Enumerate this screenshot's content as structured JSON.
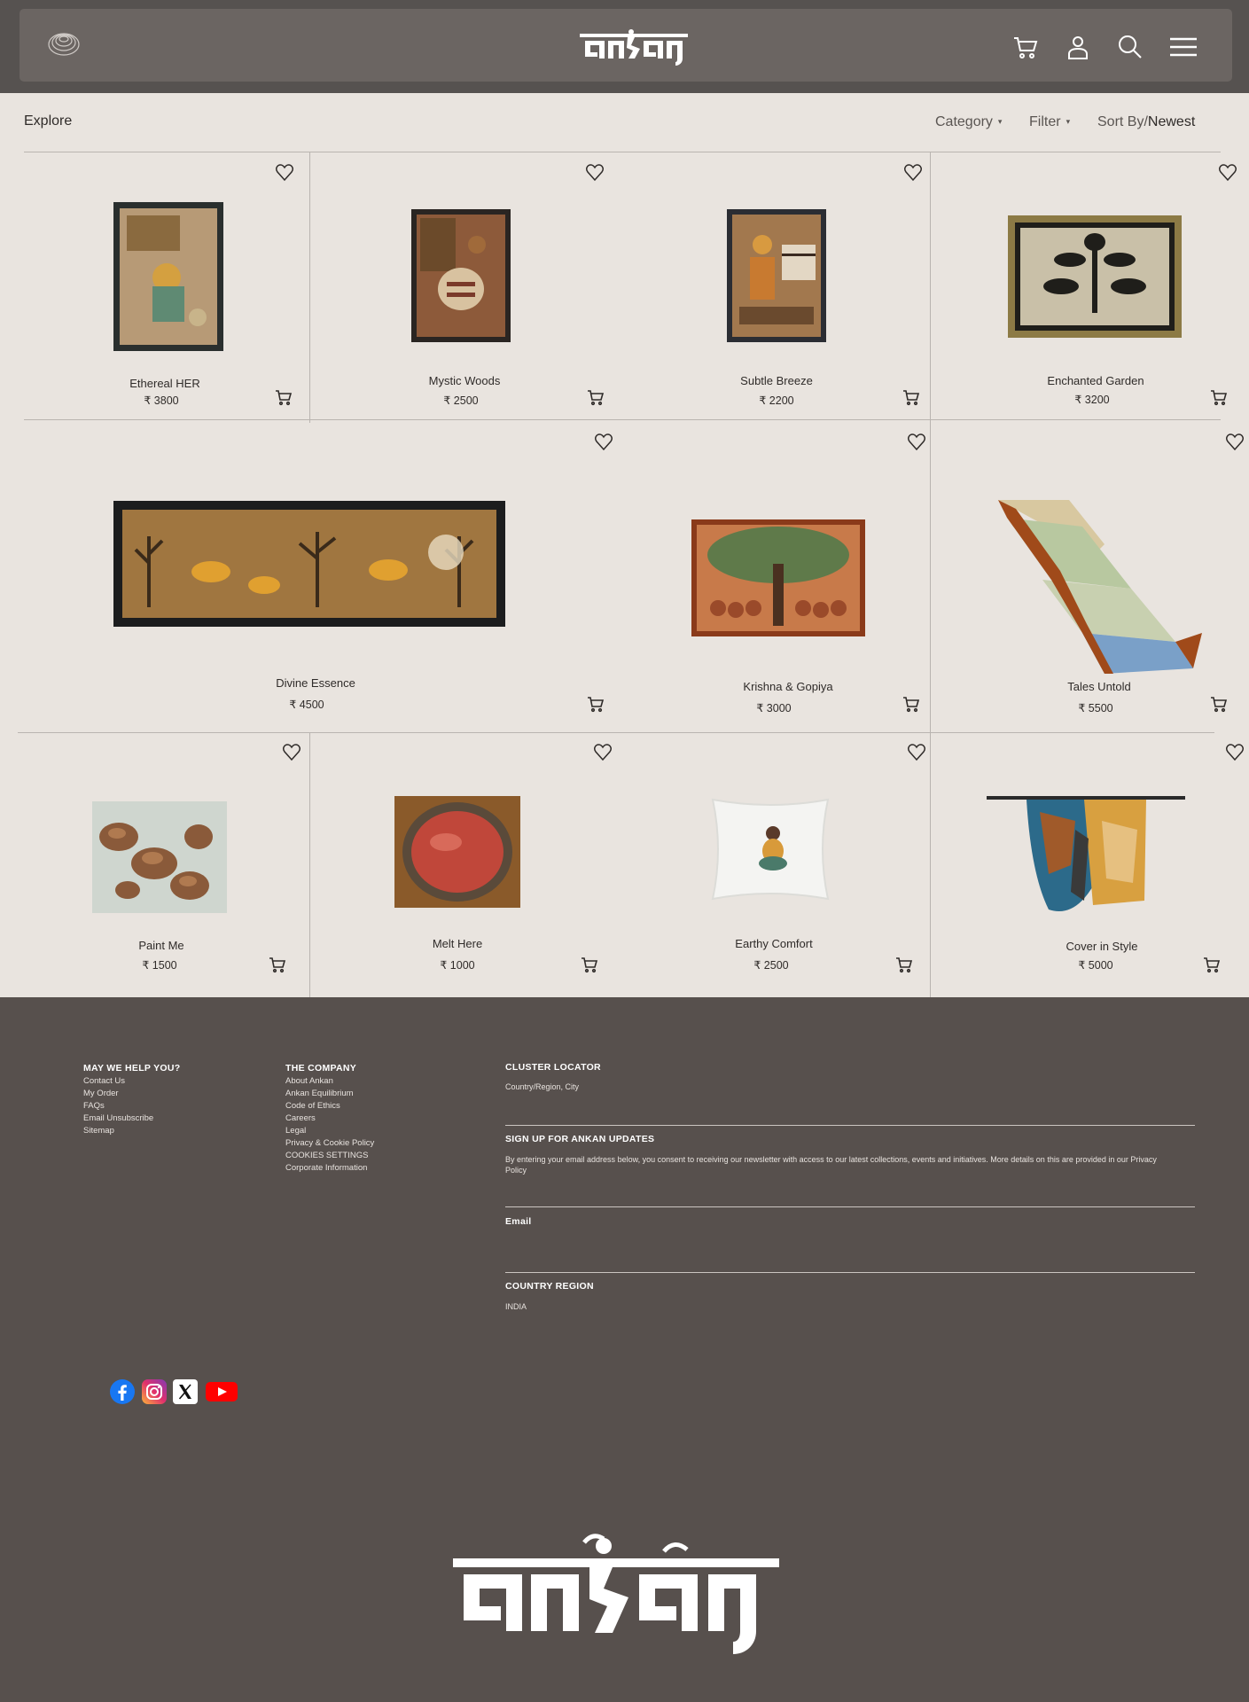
{
  "header": {
    "brand": "ankan",
    "icons": [
      "logo-mark",
      "cart-icon",
      "user-icon",
      "search-icon",
      "menu-icon"
    ]
  },
  "toolbar": {
    "explore_label": "Explore",
    "category_label": "Category",
    "filter_label": "Filter",
    "sort_prefix": "Sort By/",
    "sort_value": "Newest"
  },
  "products": [
    {
      "name": "Ethereal HER",
      "price": "₹ 3800"
    },
    {
      "name": "Mystic Woods",
      "price": "₹ 2500"
    },
    {
      "name": "Subtle Breeze",
      "price": "₹ 2200"
    },
    {
      "name": "Enchanted Garden",
      "price": "₹ 3200"
    },
    {
      "name": "Divine Essence",
      "price": "₹ 4500"
    },
    {
      "name": "Krishna & Gopiya",
      "price": "₹ 3000"
    },
    {
      "name": "Tales Untold",
      "price": "₹ 5500"
    },
    {
      "name": "Paint Me",
      "price": "₹ 1500"
    },
    {
      "name": "Melt Here",
      "price": "₹ 1000"
    },
    {
      "name": "Earthy Comfort",
      "price": "₹ 2500"
    },
    {
      "name": "Cover in Style",
      "price": "₹ 5000"
    }
  ],
  "footer": {
    "help": {
      "title": "MAY WE HELP YOU?",
      "links": [
        "Contact Us",
        "My Order",
        "FAQs",
        "Email Unsubscribe",
        "Sitemap"
      ]
    },
    "company": {
      "title": "THE COMPANY",
      "links": [
        "About Ankan",
        "Ankan Equilibrium",
        "Code of Ethics",
        "Careers",
        "Legal",
        "Privacy & Cookie Policy",
        "COOKIES SETTINGS",
        "Corporate Information"
      ]
    },
    "cluster": {
      "title": "CLUSTER LOCATOR",
      "placeholder": "Country/Region, City"
    },
    "signup": {
      "title": "SIGN UP FOR ANKAN UPDATES",
      "text": "By entering your email address below, you consent to receiving our newsletter with access to our latest collections, events and initiatives. More details on this are provided in our Privacy Policy",
      "email_label": "Email"
    },
    "country": {
      "title": "COUNTRY REGION",
      "value": "INDIA"
    },
    "social": [
      "facebook-icon",
      "instagram-icon",
      "x-icon",
      "youtube-icon"
    ],
    "brand": "ankan"
  },
  "colors": {
    "header_bg": "#565250",
    "header_inner": "#6b6562",
    "page_bg": "#e9e4df",
    "footer_bg": "#57504d"
  }
}
